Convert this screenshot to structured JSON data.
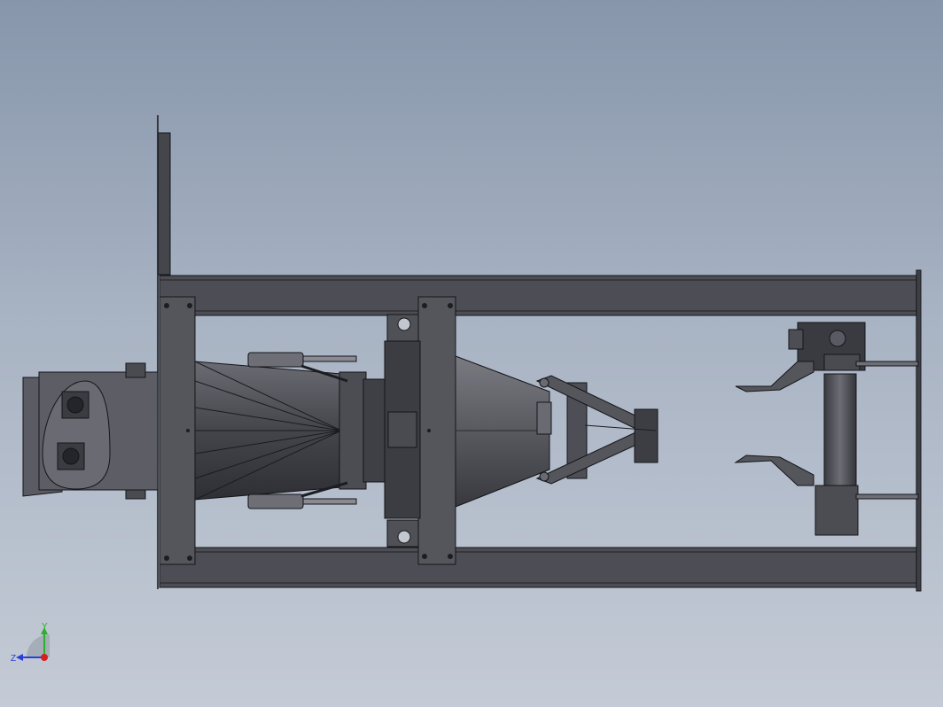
{
  "colors": {
    "background_top": "#8796ab",
    "background_bottom": "#c4cbd6",
    "metal_dark": "#3c3d43",
    "metal_mid": "#5a5b62",
    "metal_light": "#75767d",
    "edge": "#141519",
    "axis_y": "#2bb02b",
    "axis_x": "#d81e1e",
    "axis_z": "#2b3fd8"
  },
  "triad": {
    "y_label": "Y",
    "z_label": "Z",
    "icon": "coordinate-triad-icon"
  }
}
